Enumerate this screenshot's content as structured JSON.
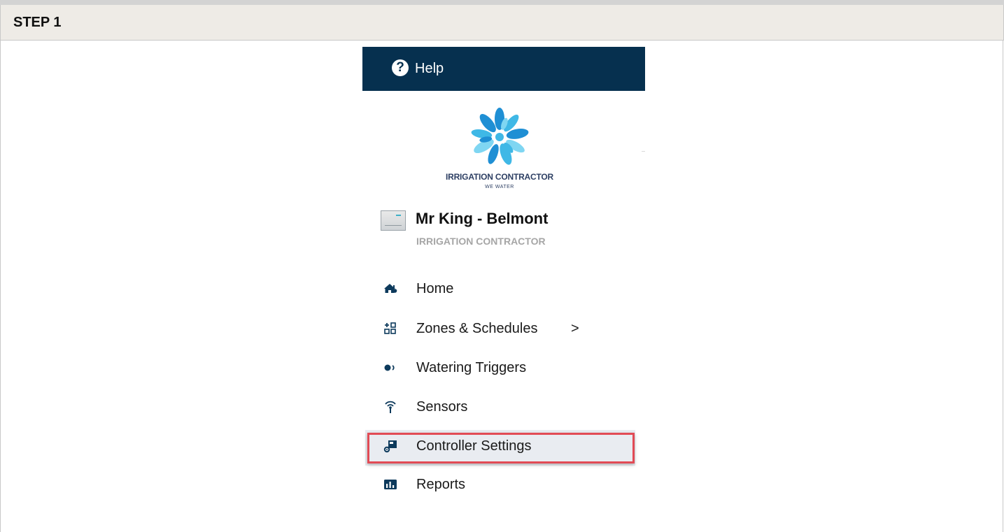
{
  "step": {
    "title": "STEP 1"
  },
  "help": {
    "label": "Help",
    "icon": "help-circle-icon",
    "bar_color": "#06304f"
  },
  "logo": {
    "line1": "IRRIGATION CONTRACTOR",
    "line2": "WE WATER",
    "colors": [
      "#1f8fd4",
      "#3fb8e6",
      "#7fd6f2"
    ]
  },
  "controller": {
    "name": "Mr King - Belmont",
    "owner": "IRRIGATION CONTRACTOR"
  },
  "nav": {
    "items": [
      {
        "label": "Home",
        "icon": "home-icon"
      },
      {
        "label": "Zones & Schedules",
        "icon": "zones-icon",
        "chevron": ">"
      },
      {
        "label": "Watering Triggers",
        "icon": "triggers-icon"
      },
      {
        "label": "Sensors",
        "icon": "sensor-antenna-icon"
      },
      {
        "label": "Controller Settings",
        "icon": "controller-settings-icon",
        "highlighted": true
      },
      {
        "label": "Reports",
        "icon": "reports-icon"
      }
    ]
  },
  "colors": {
    "icon": "#0d3a5c",
    "highlight_border": "#e24b55",
    "highlight_bg": "#e9ecf1"
  }
}
